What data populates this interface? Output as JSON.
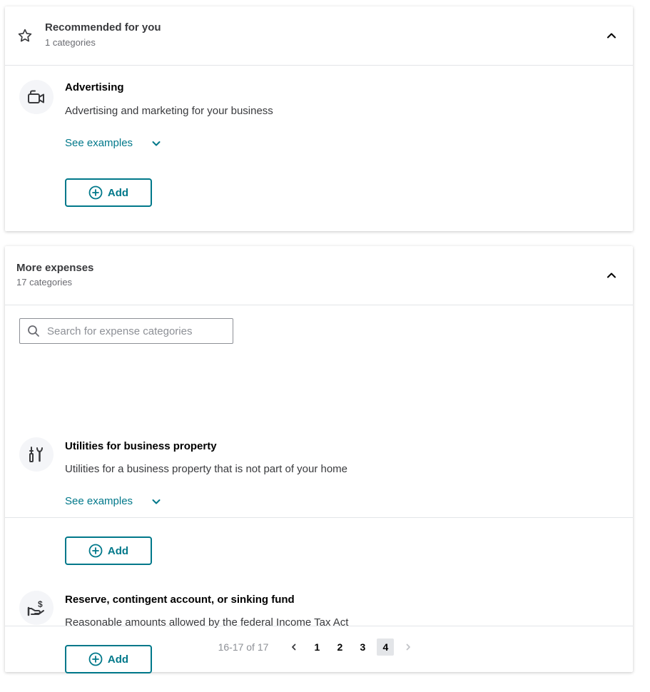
{
  "recommended": {
    "title": "Recommended for you",
    "count": "1 categories",
    "items": [
      {
        "title": "Advertising",
        "desc": "Advertising and marketing for your business",
        "see_examples": "See examples",
        "add_label": "Add",
        "icon": "video-camera-icon"
      }
    ]
  },
  "more": {
    "title": "More expenses",
    "count": "17 categories",
    "search_placeholder": "Search for expense categories",
    "items": [
      {
        "title": "Utilities for business property",
        "desc": "Utilities for a business property that is not part of your home",
        "see_examples": "See examples",
        "add_label": "Add",
        "icon": "utilities-tools-icon"
      },
      {
        "title": "Reserve, contingent account, or sinking fund",
        "desc": "Reasonable amounts allowed by the federal Income Tax Act",
        "add_label": "Add",
        "icon": "hand-money-icon"
      }
    ],
    "pagination": {
      "range": "16-17 of 17",
      "pages": [
        "1",
        "2",
        "3",
        "4"
      ],
      "current": "4"
    }
  },
  "colors": {
    "accent": "#00788a",
    "text": "#393a3d",
    "muted": "#6b6c72",
    "border": "#e3e5e8"
  }
}
